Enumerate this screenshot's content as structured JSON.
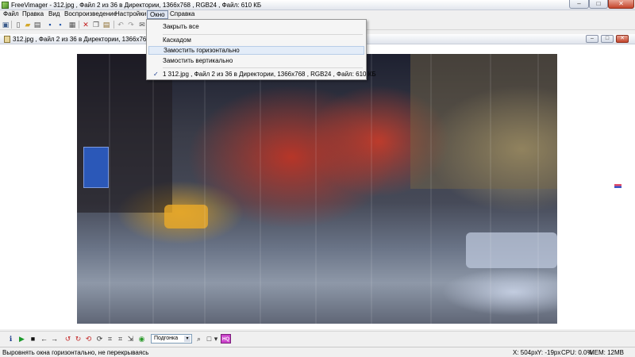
{
  "window": {
    "title": "FreeVimager - 312.jpg , Файл  2 из 36 в Директории, 1366x768 , RGB24 , Файл: 610 КБ",
    "min_icon": "minimize-icon",
    "max_icon": "maximize-icon",
    "close_icon": "close-icon",
    "min_glyph": "–",
    "max_glyph": "□",
    "close_glyph": "✕"
  },
  "menubar": {
    "items": [
      "Файл",
      "Правка",
      "Вид",
      "Воспроизведение",
      "Настройки",
      "Окно",
      "Справка"
    ],
    "active": "Окно"
  },
  "toolbar": {
    "icons": [
      {
        "name": "monitor-icon",
        "glyph": "▣",
        "color": "#3a5a8a"
      },
      {
        "name": "new-file-icon",
        "glyph": "▯",
        "color": "#555555"
      },
      {
        "name": "open-folder-icon",
        "glyph": "▰",
        "color": "#d4a82a"
      },
      {
        "name": "print-icon",
        "glyph": "▤",
        "color": "#444444"
      },
      {
        "name": "save-icon",
        "glyph": "▪",
        "color": "#1f4f9f"
      },
      {
        "name": "save-as-icon",
        "glyph": "▪",
        "color": "#2e5fae"
      },
      {
        "name": "scan-icon",
        "glyph": "▦",
        "color": "#555555"
      },
      {
        "name": "delete-icon",
        "glyph": "✕",
        "color": "#c21a1a"
      },
      {
        "name": "copy-icon",
        "glyph": "❐",
        "color": "#555555"
      },
      {
        "name": "paste-icon",
        "glyph": "▤",
        "color": "#8a6a2a"
      },
      {
        "name": "undo-icon",
        "glyph": "↶",
        "color": "#9a9a9a"
      },
      {
        "name": "redo-icon",
        "glyph": "↷",
        "color": "#9a9a9a"
      },
      {
        "name": "email-icon",
        "glyph": "✉",
        "color": "#555555"
      }
    ]
  },
  "window_menu": {
    "items": [
      "Закрыть все",
      "Каскадом",
      "Замостить горизонтально",
      "Замостить вертикально",
      "1 312.jpg , Файл  2 из 36 в Директории, 1366x768 , RGB24 , Файл: 610 КБ"
    ],
    "hover_index": 2,
    "checked_index": 4,
    "check_glyph": "✓"
  },
  "child_window": {
    "title": "312.jpg , Файл  2 из 36 в Директории, 1366x768 , RGB24 , Файл: 610 КБ",
    "min_glyph": "–",
    "max_glyph": "□",
    "close_glyph": "✕"
  },
  "bottom_toolbar": {
    "icons": [
      {
        "name": "info-icon",
        "glyph": "ℹ",
        "color": "#1a3a8a"
      },
      {
        "name": "play-icon",
        "glyph": "▶",
        "color": "#1a9a2a"
      },
      {
        "name": "stop-icon",
        "glyph": "■",
        "color": "#111111"
      },
      {
        "name": "previous-icon",
        "glyph": "←",
        "color": "#111111"
      },
      {
        "name": "next-icon",
        "glyph": "→",
        "color": "#111111"
      },
      {
        "name": "rotate-left-icon",
        "glyph": "↺",
        "color": "#c42a2a"
      },
      {
        "name": "rotate-right-icon",
        "glyph": "↻",
        "color": "#c42a2a"
      },
      {
        "name": "rotate-lossless-icon",
        "glyph": "⟲",
        "color": "#c42a2a"
      },
      {
        "name": "refresh-icon",
        "glyph": "⟳",
        "color": "#333333"
      },
      {
        "name": "crop-icon",
        "glyph": "⌗",
        "color": "#333333"
      },
      {
        "name": "crop-lossless-icon",
        "glyph": "⌗",
        "color": "#333333"
      },
      {
        "name": "resize-icon",
        "glyph": "⇲",
        "color": "#333333"
      },
      {
        "name": "color-palette-icon",
        "glyph": "◉",
        "color": "#2a9a2a"
      },
      {
        "name": "zoom-icon",
        "glyph": "⌕",
        "color": "#333333"
      },
      {
        "name": "background-color-icon",
        "glyph": "□",
        "color": "#333333"
      },
      {
        "name": "dropdown-arrow-icon",
        "glyph": "▾",
        "color": "#333333"
      }
    ],
    "fit_label": "Подгонка",
    "fit_arrow": "▾",
    "hq_label": "HQ"
  },
  "statusbar": {
    "hint": "Выровнять окна горизонтально, не перекрываясь",
    "x": "X: 504px",
    "y": "Y: -19px",
    "cpu": "CPU: 0.0%",
    "mem": "MEM: 12MB"
  },
  "colors": {
    "menu_hover": "#e3ecf8",
    "photo_red": "#c43424",
    "sign_blue": "#2b58b8"
  }
}
